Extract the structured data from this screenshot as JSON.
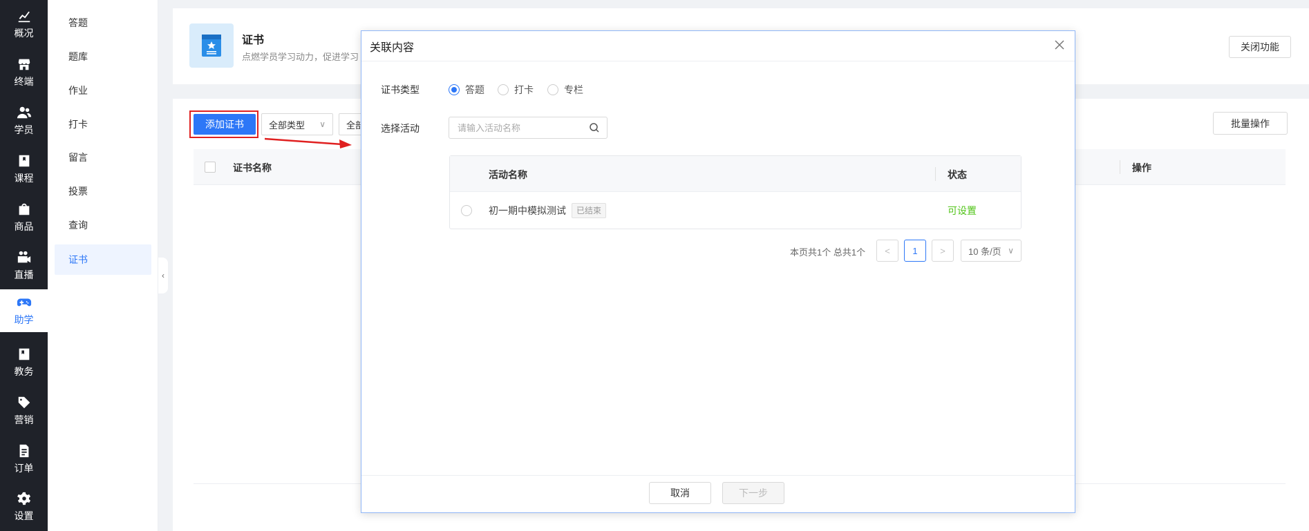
{
  "rail": {
    "items": [
      {
        "label": "概况",
        "icon": "chart-up-icon"
      },
      {
        "label": "终端",
        "icon": "store-icon"
      },
      {
        "label": "学员",
        "icon": "users-icon"
      },
      {
        "label": "课程",
        "icon": "book-icon"
      },
      {
        "label": "商品",
        "icon": "bag-icon"
      },
      {
        "label": "直播",
        "icon": "camera-icon"
      },
      {
        "label": "助学",
        "icon": "gamepad-icon"
      },
      {
        "label": "教务",
        "icon": "notebook-icon"
      },
      {
        "label": "营销",
        "icon": "tag-icon"
      },
      {
        "label": "订单",
        "icon": "document-icon"
      },
      {
        "label": "设置",
        "icon": "gear-icon"
      }
    ],
    "active_index": 6,
    "active_color": "#2d77f7"
  },
  "subnav": {
    "items": [
      "答题",
      "题库",
      "作业",
      "打卡",
      "留言",
      "投票",
      "查询",
      "证书"
    ],
    "active": "证书"
  },
  "header": {
    "title": "证书",
    "desc": "点燃学员学习动力，促进学习",
    "close_feature": "关闭功能"
  },
  "toolbar": {
    "add_cert": "添加证书",
    "filter_type": "全部类型",
    "filter_second": "全部",
    "batch": "批量操作"
  },
  "main_table": {
    "col_name": "证书名称",
    "col_action": "操作"
  },
  "modal": {
    "title": "关联内容",
    "cert_type_label": "证书类型",
    "cert_types": [
      "答题",
      "打卡",
      "专栏"
    ],
    "cert_type_selected": 0,
    "activity_label": "选择活动",
    "search_placeholder": "请输入活动名称",
    "table": {
      "col_name": "活动名称",
      "col_status": "状态",
      "rows": [
        {
          "name": "初一期中模拟测试",
          "tag": "已结束",
          "status": "可设置"
        }
      ]
    },
    "pager": {
      "summary": "本页共1个 总共1个",
      "prev": "<",
      "current": "1",
      "next": ">",
      "page_size": "10 条/页"
    },
    "cancel": "取消",
    "next_step": "下一步"
  },
  "colors": {
    "primary": "#2d77f7",
    "success": "#52c41a",
    "highlight": "#e02020",
    "rail_bg": "#1f2229"
  }
}
